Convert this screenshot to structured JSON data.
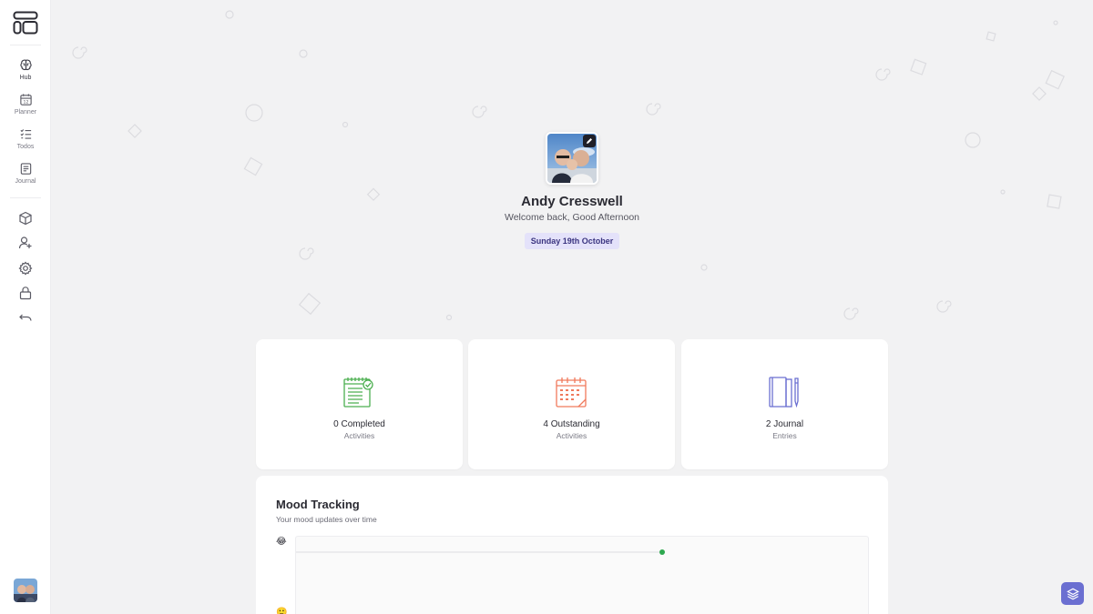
{
  "sidebar": {
    "nav": [
      {
        "label": "Hub",
        "icon": "brain-icon",
        "active": true
      },
      {
        "label": "Planner",
        "icon": "calendar-icon"
      },
      {
        "label": "Todos",
        "icon": "checklist-icon"
      },
      {
        "label": "Journal",
        "icon": "notebook-icon"
      }
    ],
    "tools": [
      "cube-icon",
      "add-user-icon",
      "gear-icon",
      "lock-icon",
      "undo-icon"
    ]
  },
  "profile": {
    "name": "Andy Cresswell",
    "greeting": "Welcome back, Good Afternoon",
    "date": "Sunday 19th October"
  },
  "stats": [
    {
      "title": "0 Completed",
      "subtitle": "Activities",
      "icon": "checked-notepad-icon",
      "color": "#4caf50"
    },
    {
      "title": "4 Outstanding",
      "subtitle": "Activities",
      "icon": "calendar-icon",
      "color": "#f07a5c"
    },
    {
      "title": "2 Journal",
      "subtitle": "Entries",
      "icon": "journal-books-icon",
      "color": "#6b6fd1"
    }
  ],
  "mood": {
    "title": "Mood Tracking",
    "subtitle": "Your mood updates over time",
    "emoji_top": "😂",
    "emoji_bottom": "🙂",
    "point_color": "#2ea84f"
  },
  "colors": {
    "accent": "#6b6fd1",
    "date_pill_bg": "#e4e2fa",
    "date_pill_text": "#3b3580"
  }
}
